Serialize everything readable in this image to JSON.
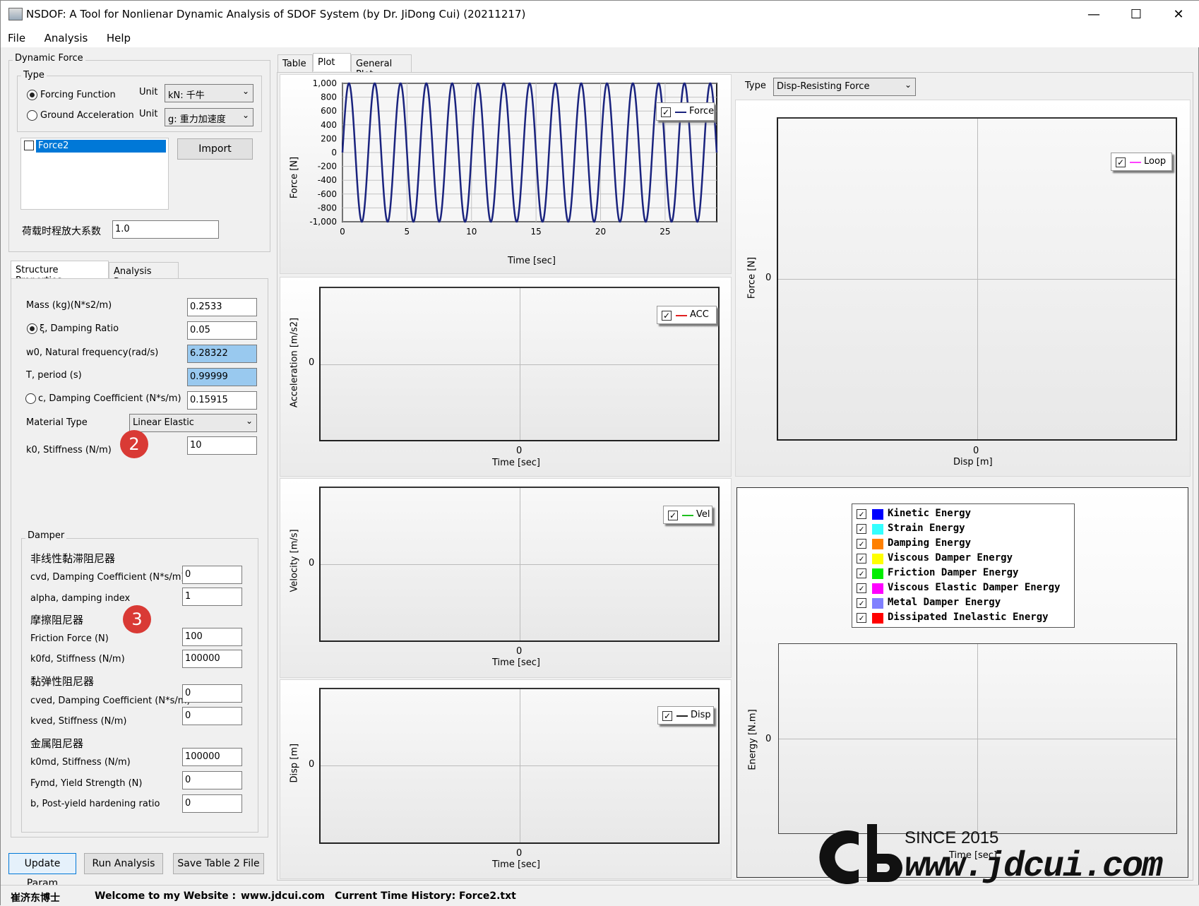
{
  "window": {
    "title": "NSDOF: A Tool for Nonlienar Dynamic Analysis of SDOF System (by Dr. JiDong Cui) (20211217)",
    "minimize": "—",
    "maximize": "☐",
    "close": "✕"
  },
  "menu": [
    "File",
    "Analysis",
    "Help"
  ],
  "dynamic_force": {
    "group_label": "Dynamic Force",
    "type_label": "Type",
    "forcing_function": "Forcing Function",
    "ground_acceleration": "Ground Acceleration",
    "unit_label": "Unit",
    "unit1": "kN: 千牛",
    "unit2": "g: 重力加速度",
    "list_item": "Force2",
    "import_button": "Import",
    "scale_label": "荷载时程放大系数",
    "scale_value": "1.0"
  },
  "left_tabs": [
    "Structure Properties",
    "Analysis Param"
  ],
  "structure": {
    "mass_label": "Mass (kg)(N*s2/m)",
    "mass": "0.2533",
    "damping_ratio_label": "ξ, Damping Ratio",
    "damping_ratio": "0.05",
    "w0_label": "w0, Natural frequency(rad/s)",
    "w0": "6.28322",
    "period_label": "T, period (s)",
    "period": "0.99999",
    "c_label": "c, Damping Coefficient (N*s/m)",
    "c": "0.15915",
    "material_label": "Material Type",
    "material": "Linear Elastic",
    "k0_label": "k0, Stiffness (N/m)",
    "k0": "10"
  },
  "badges": {
    "b2": "2",
    "b3": "3"
  },
  "damper": {
    "group_label": "Damper",
    "nonlinear_title": "非线性黏滞阻尼器",
    "cvd_label": "cvd, Damping Coefficient (N*s/m)",
    "cvd": "0",
    "alpha_label": "alpha, damping index",
    "alpha": "1",
    "friction_title": "摩擦阻尼器",
    "friction_label": "Friction Force (N)",
    "friction": "100",
    "k0fd_label": "k0fd, Stiffness (N/m)",
    "k0fd": "100000",
    "viscoelastic_title": "黏弹性阻尼器",
    "cved_label": "cved, Damping Coefficient (N*s/m)",
    "cved": "0",
    "kved_label": "kved, Stiffness (N/m)",
    "kved": "0",
    "metal_title": "金属阻尼器",
    "k0md_label": "k0md, Stiffness (N/m)",
    "k0md": "100000",
    "fymd_label": "Fymd, Yield Strength (N)",
    "fymd": "0",
    "b_label": "b, Post-yield hardening ratio",
    "b": "0"
  },
  "buttons": {
    "update": "Update Param",
    "run": "Run Analysis",
    "save": "Save Table 2 File"
  },
  "main_tabs": [
    "Table",
    "Plot",
    "General Plot"
  ],
  "force_plot": {
    "ylabel": "Force [N]",
    "xlabel": "Time [sec]",
    "legend": "Force",
    "yticks": [
      "1,000",
      "800",
      "600",
      "400",
      "200",
      "0",
      "-200",
      "-400",
      "-600",
      "-800",
      "-1,000"
    ],
    "xticks": [
      "0",
      "5",
      "10",
      "15",
      "20",
      "25"
    ]
  },
  "acc_plot": {
    "ylabel": "Acceleration [m/s2]",
    "xlabel": "Time [sec]",
    "legend": "ACC",
    "ytick": "0",
    "xtick": "0"
  },
  "vel_plot": {
    "ylabel": "Velocity [m/s]",
    "xlabel": "Time [sec]",
    "legend": "Vel",
    "ytick": "0",
    "xtick": "0"
  },
  "disp_plot": {
    "ylabel": "Disp [m]",
    "xlabel": "Time [sec]",
    "legend": "Disp",
    "ytick": "0",
    "xtick": "0"
  },
  "loop_plot": {
    "type_label": "Type",
    "type_value": "Disp-Resisting Force",
    "ylabel": "Force [N]",
    "xlabel": "Disp [m]",
    "legend": "Loop",
    "ytick": "0",
    "xtick": "0"
  },
  "energy_plot": {
    "ylabel": "Energy [N.m]",
    "xlabel": "Time [sec]",
    "ytick": "0",
    "legend": [
      {
        "label": "Kinetic Energy",
        "color": "#0000ff"
      },
      {
        "label": "Strain Energy",
        "color": "#33ffff"
      },
      {
        "label": "Damping Energy",
        "color": "#ff8000"
      },
      {
        "label": "Viscous Damper Energy",
        "color": "#ffff00"
      },
      {
        "label": "Friction Damper Energy",
        "color": "#00ee00"
      },
      {
        "label": "Viscous Elastic Damper Energy",
        "color": "#ff00ff"
      },
      {
        "label": "Metal Damper Energy",
        "color": "#8080ff"
      },
      {
        "label": "Dissipated Inelastic Energy",
        "color": "#ff0000"
      }
    ]
  },
  "watermark": {
    "since": "SINCE 2015",
    "url": "www.jdcui.com"
  },
  "status": {
    "name": "崔济东博士",
    "welcome": "Welcome to my Website :",
    "site": "www.jdcui.com",
    "current": "Current Time History: Force2.txt"
  },
  "chart_data": {
    "type": "line",
    "title": "",
    "xlabel": "Time [sec]",
    "ylabel": "Force [N]",
    "xlim": [
      0,
      29
    ],
    "ylim": [
      -1000,
      1000
    ],
    "series": [
      {
        "name": "Force",
        "function": "1000*sin(2*pi*t/2)",
        "period": 2,
        "amplitude": 1000
      }
    ],
    "grid": true,
    "legend_position": "top-right"
  }
}
